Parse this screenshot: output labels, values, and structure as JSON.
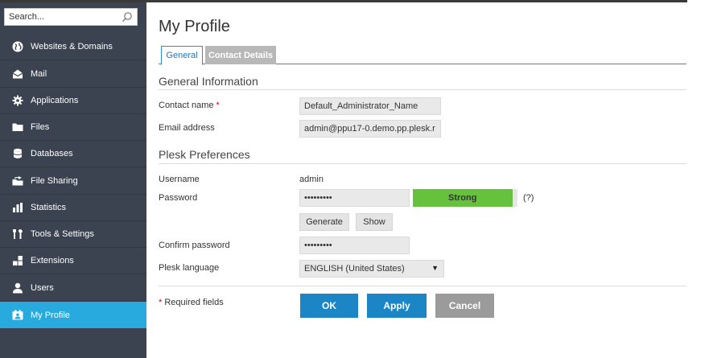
{
  "sidebar": {
    "search": {
      "placeholder": "Search..."
    },
    "items": [
      {
        "label": "Websites & Domains",
        "icon": "globe-icon"
      },
      {
        "label": "Mail",
        "icon": "mail-icon"
      },
      {
        "label": "Applications",
        "icon": "gear-icon"
      },
      {
        "label": "Files",
        "icon": "folder-icon"
      },
      {
        "label": "Databases",
        "icon": "database-icon"
      },
      {
        "label": "File Sharing",
        "icon": "file-sharing-icon"
      },
      {
        "label": "Statistics",
        "icon": "bar-chart-icon"
      },
      {
        "label": "Tools & Settings",
        "icon": "tools-icon"
      },
      {
        "label": "Extensions",
        "icon": "extensions-icon"
      },
      {
        "label": "Users",
        "icon": "user-icon"
      },
      {
        "label": "My Profile",
        "icon": "profile-icon",
        "active": true
      }
    ]
  },
  "main": {
    "title": "My Profile",
    "tabs": [
      {
        "label": "General",
        "active": true
      },
      {
        "label": "Contact Details",
        "active": false
      }
    ],
    "general_info": {
      "title": "General Information",
      "contact_name_label": "Contact name",
      "required_mark": "*",
      "contact_name_value": "Default_Administrator_Name",
      "email_label": "Email address",
      "email_value": "admin@ppu17-0.demo.pp.plesk.r"
    },
    "preferences": {
      "title": "Plesk Preferences",
      "username_label": "Username",
      "username_value": "admin",
      "password_label": "Password",
      "password_value": "•••••••••",
      "strength_label": "Strong",
      "strength_fraction": 0.95,
      "help_label": "(?)",
      "generate_label": "Generate",
      "show_label": "Show",
      "confirm_label": "Confirm password",
      "confirm_value": "•••••••••",
      "language_label": "Plesk language",
      "language_value": "ENGLISH (United States)"
    },
    "footer": {
      "required_mark": "*",
      "required_note": "Required fields",
      "ok_label": "OK",
      "apply_label": "Apply",
      "cancel_label": "Cancel"
    }
  },
  "colors": {
    "sidebar_bg": "#3b4350",
    "active_item": "#28aade",
    "primary_button": "#1b85c6",
    "cancel_button": "#9b9b9b",
    "strength_strong": "#66c23c",
    "tab_border": "#2f8fc4"
  }
}
